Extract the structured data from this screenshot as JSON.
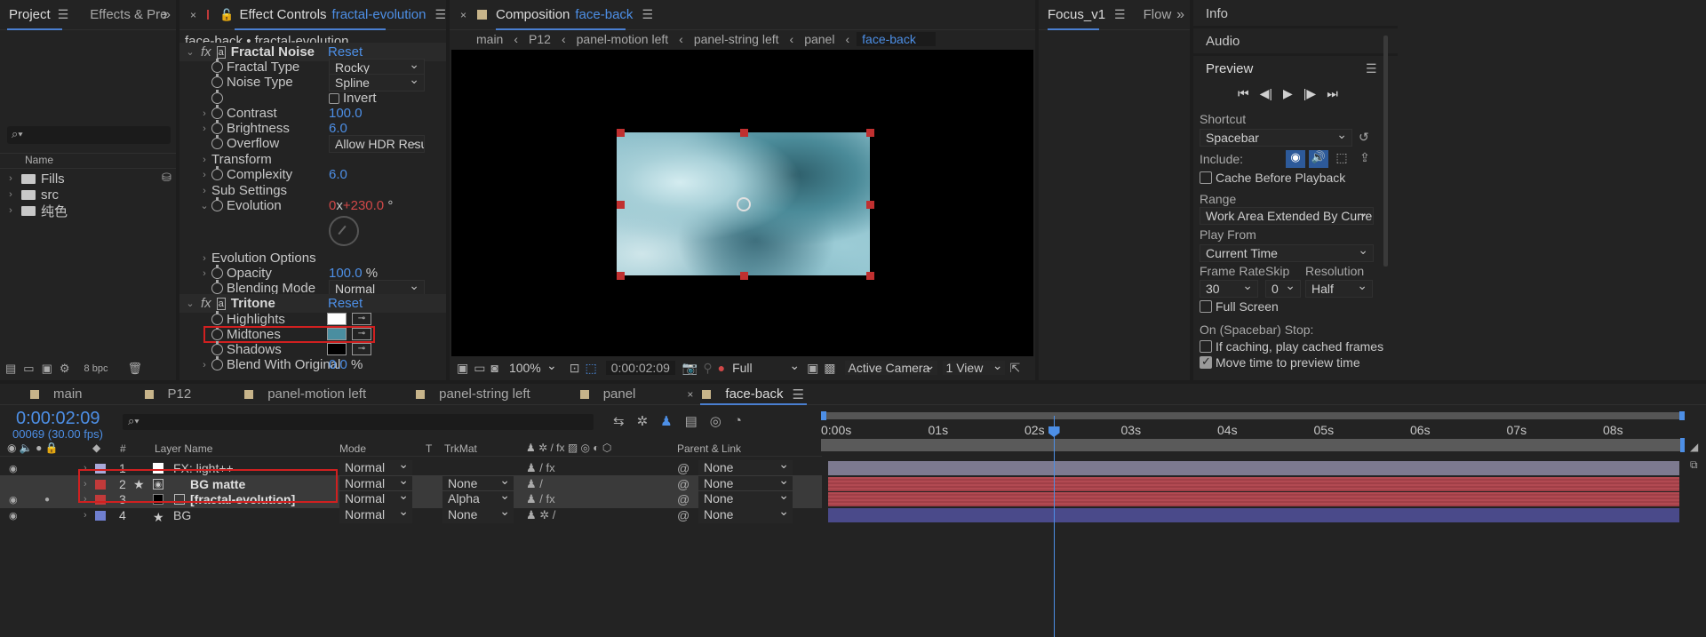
{
  "project": {
    "tabs": [
      "Project",
      "Effects & Pre"
    ],
    "name_header": "Name",
    "items": [
      {
        "name": "Fills",
        "icon": "folder-icon"
      },
      {
        "name": "src",
        "icon": "folder-icon"
      },
      {
        "name": "纯色",
        "icon": "folder-icon"
      }
    ],
    "bpc": "8 bpc"
  },
  "effect_controls": {
    "tab_prefix": "Effect Controls",
    "tab_layer": "fractal-evolution",
    "subtitle": "face-back • fractal-evolution",
    "fractal": {
      "name": "Fractal Noise",
      "reset": "Reset",
      "props": {
        "fractal_type": {
          "label": "Fractal Type",
          "value": "Rocky"
        },
        "noise_type": {
          "label": "Noise Type",
          "value": "Spline"
        },
        "invert": "Invert",
        "contrast": {
          "label": "Contrast",
          "value": "100.0"
        },
        "brightness": {
          "label": "Brightness",
          "value": "6.0"
        },
        "overflow": {
          "label": "Overflow",
          "value": "Allow HDR Resul"
        },
        "transform": "Transform",
        "complexity": {
          "label": "Complexity",
          "value": "6.0"
        },
        "sub_settings": "Sub Settings",
        "evolution": {
          "label": "Evolution",
          "rev": "0",
          "x": "x",
          "deg": "+230.0",
          "unit": "°"
        },
        "evo_options": "Evolution Options",
        "opacity": {
          "label": "Opacity",
          "value": "100.0",
          "unit": "%"
        },
        "blending": {
          "label": "Blending Mode",
          "value": "Normal"
        }
      }
    },
    "tritone": {
      "name": "Tritone",
      "reset": "Reset",
      "highlights": "Highlights",
      "midtones": "Midtones",
      "shadows": "Shadows",
      "blend": {
        "label": "Blend With Original",
        "value": "0.0",
        "unit": "%"
      },
      "colors": {
        "highlights": "#ffffff",
        "midtones": "#4a8ea0",
        "shadows": "#000000"
      }
    }
  },
  "composition": {
    "tab_prefix": "Composition",
    "tab_name": "face-back",
    "breadcrumbs": [
      "main",
      "P12",
      "panel-motion left",
      "panel-string left",
      "panel",
      "face-back"
    ],
    "footer": {
      "zoom": "100%",
      "timecode": "0:00:02:09",
      "resolution": "Full",
      "camera": "Active Camera",
      "views": "1 View"
    }
  },
  "focus": {
    "tabs": [
      "Focus_v1",
      "Flow"
    ]
  },
  "right": {
    "sections": [
      "Info",
      "Audio"
    ],
    "preview": {
      "title": "Preview",
      "shortcut_label": "Shortcut",
      "shortcut": "Spacebar",
      "include": "Include:",
      "cache": "Cache Before Playback",
      "range_label": "Range",
      "range": "Work Area Extended By Current...",
      "play_from_label": "Play From",
      "play_from": "Current Time",
      "frame_rate_label": "Frame Rate",
      "skip_label": "Skip",
      "res_label": "Resolution",
      "frame_rate": "30",
      "skip": "0",
      "res": "Half",
      "full_screen": "Full Screen",
      "stop_label": "On (Spacebar) Stop:",
      "if_caching": "If caching, play cached frames",
      "move_time": "Move time to preview time"
    }
  },
  "timeline": {
    "tabs": [
      "main",
      "P12",
      "panel-motion left",
      "panel-string left",
      "panel",
      "face-back"
    ],
    "timecode": "0:00:02:09",
    "frames": "00069 (30.00 fps)",
    "headers": {
      "num": "#",
      "layer": "Layer Name",
      "mode": "Mode",
      "t": "T",
      "trkmat": "TrkMat",
      "parent": "Parent & Link"
    },
    "ruler": [
      "0:00s",
      "01s",
      "02s",
      "03s",
      "04s",
      "05s",
      "06s",
      "07s",
      "08s"
    ],
    "playhead_seconds": 2.3,
    "layers": [
      {
        "num": "1",
        "name": "FX: light++",
        "mode": "Normal",
        "trkmat": "",
        "parent": "None",
        "color": "#a9a9d9"
      },
      {
        "num": "2",
        "name": "BG matte",
        "mode": "Normal",
        "trkmat": "None",
        "parent": "None",
        "color": "#c03a3a"
      },
      {
        "num": "3",
        "name": "[fractal-evolution]",
        "mode": "Normal",
        "trkmat": "Alpha",
        "parent": "None",
        "color": "#c03a3a"
      },
      {
        "num": "4",
        "name": "BG",
        "mode": "Normal",
        "trkmat": "None",
        "parent": "None",
        "color": "#6f7fcf"
      }
    ]
  }
}
